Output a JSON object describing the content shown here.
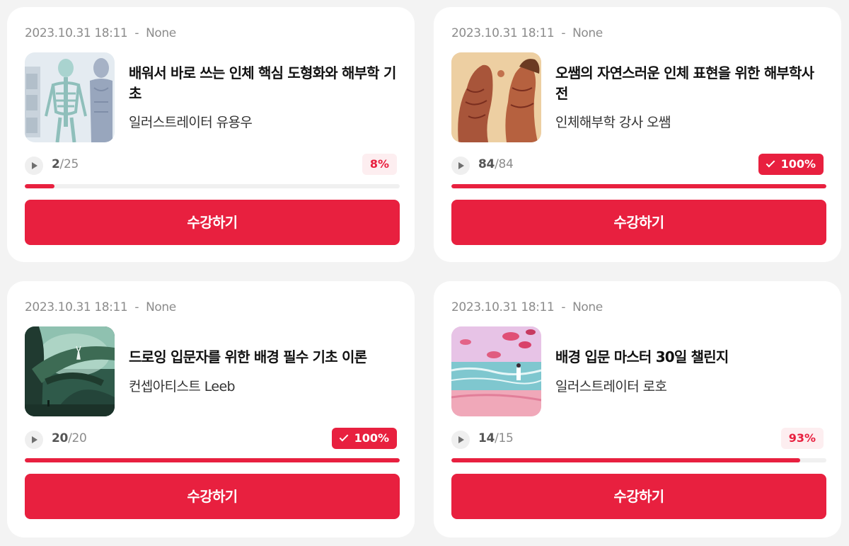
{
  "button_label": "수강하기",
  "accent_color": "#e8203f",
  "courses": [
    {
      "date": "2023.10.31 18:11",
      "separator": "-",
      "status": "None",
      "title": "배워서 바로 쓰는 인체 핵심 도형화와 해부학 기초",
      "author": "일러스트레이터 유용우",
      "progress_done": "2",
      "progress_total": "/25",
      "percent": "8%",
      "fraction": 0.08,
      "completed": false,
      "thumbnail": "anatomy-skeleton-thumbnail"
    },
    {
      "date": "2023.10.31 18:11",
      "separator": "-",
      "status": "None",
      "title": "오쌤의 자연스러운 인체 표현을 위한 해부학사전",
      "author": "인체해부학 강사 오쌤",
      "progress_done": "84",
      "progress_total": "/84",
      "percent": "100%",
      "fraction": 1.0,
      "completed": true,
      "thumbnail": "anatomy-figures-thumbnail"
    },
    {
      "date": "2023.10.31 18:11",
      "separator": "-",
      "status": "None",
      "title": "드로잉 입문자를 위한 배경 필수 기초 이론",
      "author": "컨셉아티스트 Leeb",
      "progress_done": "20",
      "progress_total": "/20",
      "percent": "100%",
      "fraction": 1.0,
      "completed": true,
      "thumbnail": "forest-scene-thumbnail"
    },
    {
      "date": "2023.10.31 18:11",
      "separator": "-",
      "status": "None",
      "title": "배경 입문 마스터 30일 챌린지",
      "author": "일러스트레이터 로호",
      "progress_done": "14",
      "progress_total": "/15",
      "percent": "93%",
      "fraction": 0.93,
      "completed": false,
      "thumbnail": "seaside-scene-thumbnail"
    }
  ]
}
